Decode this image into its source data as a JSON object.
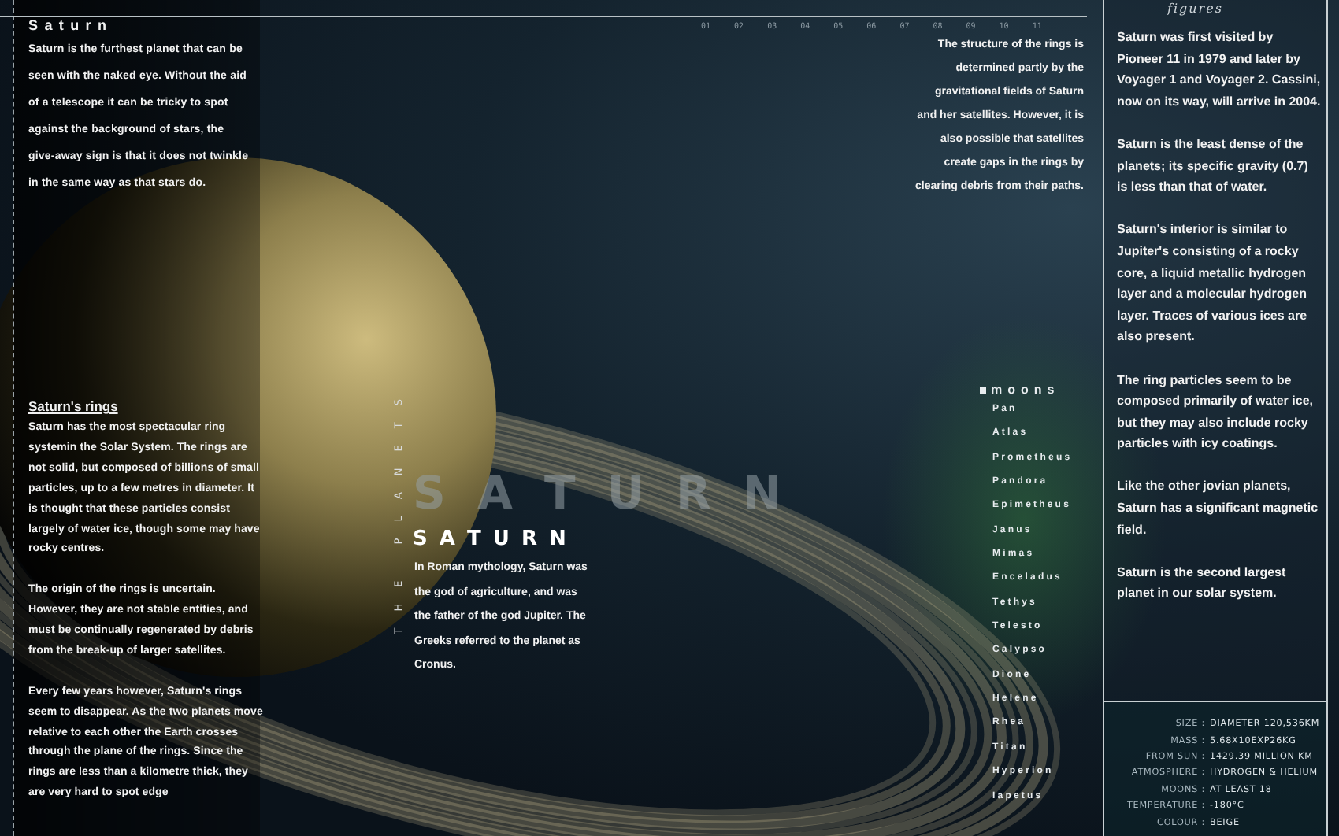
{
  "header": {
    "column_numbers": [
      "01",
      "02",
      "03",
      "04",
      "05",
      "06",
      "07",
      "08",
      "09",
      "10",
      "11"
    ],
    "figures_label": "figures"
  },
  "intro": {
    "title": "Saturn",
    "text": "Saturn is the furthest planet that can be seen with the naked eye. Without the aid of a telescope it can be tricky to spot against the background of stars, the give-away sign is that it does not twinkle in the same way as that stars do."
  },
  "rings": {
    "title": "Saturn's rings",
    "paragraphs": [
      "Saturn has the most spectacular ring systemin the Solar System. The rings are not solid, but composed of billions of small particles, up to a few metres in diameter. It is thought that these particles consist largely of water ice, though some may have rocky centres.",
      "The origin of the rings is uncertain. However, they are not stable entities, and must be continually regenerated by debris from the break-up of larger satellites.",
      "Every few years however, Saturn's rings seem to disappear. As the two planets move relative to each other the Earth crosses through the plane of the rings. Since the rings are less than a kilometre thick, they are very hard to spot edge"
    ]
  },
  "structure_note": "The structure of the rings is determined partly by the gravitational fields of Saturn and her satellites. However, it is also possible that satellites create gaps in the rings by clearing debris from their paths.",
  "title_block": {
    "backdrop": "S A T U R N",
    "title": "S A T U R N",
    "vertical": "THE PLANETS",
    "mythology": "In Roman mythology, Saturn was the god of agriculture, and was the father of the god Jupiter. The Greeks referred to the planet as Cronus."
  },
  "moons": {
    "title": "moons",
    "items": [
      "Pan",
      "Atlas",
      "Prometheus",
      "Pandora",
      "Epimetheus",
      "Janus",
      "Mimas",
      "Enceladus",
      "Tethys",
      "Telesto",
      "Calypso",
      "Dione",
      "Helene",
      "Rhea",
      "Titan",
      "Hyperion",
      "Iapetus"
    ]
  },
  "facts": [
    "Saturn was first visited by Pioneer 11 in 1979 and later by Voyager 1 and Voyager 2. Cassini, now on its way, will arrive in 2004.",
    "Saturn is the least dense of the planets; its specific gravity (0.7) is less than that of water.",
    "Saturn's interior is similar to Jupiter's consisting of a rocky core, a liquid metallic hydrogen layer and a molecular hydrogen layer. Traces of various ices are also present.",
    "The ring particles seem to be composed primarily of water ice, but they may also include rocky particles with icy coatings.",
    "Like the other jovian planets, Saturn has a significant magnetic field.",
    "Saturn is the second largest planet in our solar system."
  ],
  "stats": [
    {
      "label": "SIZE :",
      "value": "DIAMETER 120,536KM"
    },
    {
      "label": "MASS :",
      "value": "5.68X10EXP26KG"
    },
    {
      "label": "FROM SUN :",
      "value": "1429.39 MILLION KM"
    },
    {
      "label": "ATMOSPHERE :",
      "value": "HYDROGEN & HELIUM"
    },
    {
      "label": "MOONS :",
      "value": "AT LEAST 18"
    },
    {
      "label": "TEMPERATURE :",
      "value": "-180°C"
    },
    {
      "label": "COLOUR :",
      "value": "BEIGE"
    }
  ]
}
